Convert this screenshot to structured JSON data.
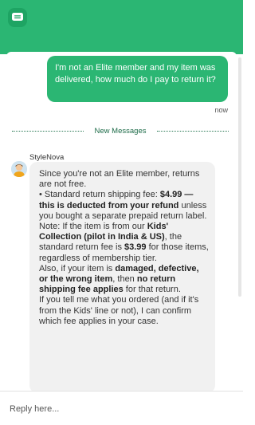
{
  "header": {
    "brand_icon": "chat-bubble-icon",
    "brand_color": "#2bb673"
  },
  "conversation": {
    "user_message": "I'm not an Elite member and my item was delivered, how much do I pay to return it?",
    "user_timestamp": "now",
    "divider_label": "New Messages",
    "bot_name": "StyleNova",
    "bot_avatar_icon": "bot-avatar-icon",
    "bot_message": {
      "p1": "Since you're not an Elite member, returns are not free.",
      "p2_pre": "• Standard return shipping fee: ",
      "p2_b1": "$4.99 — this is ",
      "p2_b2": "deducted from your refund",
      "p2_post": " unless you bought a separate prepaid return label.",
      "p3_pre": "Note: If the item is from our ",
      "p3_b1": "Kids' Collection (pilot in India & US)",
      "p3_mid": ", the standard return fee is ",
      "p3_b2": "$3.99",
      "p3_post": " for those items, regardless of membership tier.",
      "p4_pre": "Also, if your item is ",
      "p4_b1": "damaged, defective, or the wrong item",
      "p4_mid": ", then ",
      "p4_b2": "no return shipping fee applies",
      "p4_post": " for that return.",
      "p5": "If you tell me what you ordered (and if it's from the Kids' line or not), I can confirm which fee applies in your case."
    }
  },
  "composer": {
    "placeholder": "Reply here..."
  },
  "colors": {
    "accent": "#2bb673",
    "bot_bubble": "#f1f1f1"
  }
}
